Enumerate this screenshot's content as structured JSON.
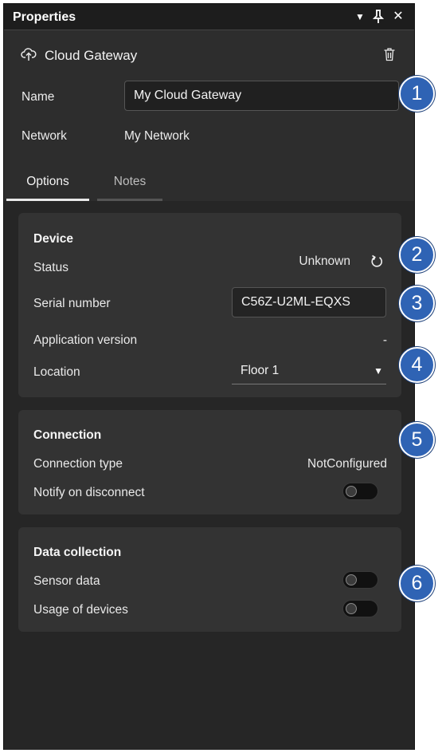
{
  "titlebar": {
    "title": "Properties",
    "icons": [
      "dropdown-arrow-icon",
      "pin-icon",
      "close-icon"
    ],
    "glyphs": {
      "menu": "▼",
      "pin": "🖈",
      "close": "✕"
    }
  },
  "header": {
    "icon": "cloud-upload-icon",
    "title": "Cloud Gateway",
    "delete_icon": "trash-icon"
  },
  "fields": {
    "name_label": "Name",
    "name_value": "My Cloud Gateway",
    "network_label": "Network",
    "network_value": "My Network"
  },
  "tabs": [
    {
      "label": "Options",
      "active": true
    },
    {
      "label": "Notes",
      "active": false
    }
  ],
  "device": {
    "title": "Device",
    "status_label": "Status",
    "status_value": "Unknown",
    "status_icon": "refresh-icon",
    "serial_label": "Serial number",
    "serial_value": "C56Z-U2ML-EQXS",
    "app_version_label": "Application version",
    "app_version_value": "-",
    "location_label": "Location",
    "location_value": "Floor 1",
    "location_caret": "▼"
  },
  "connection": {
    "title": "Connection",
    "type_label": "Connection type",
    "type_value": "NotConfigured",
    "notify_label": "Notify on disconnect",
    "notify_enabled": false
  },
  "data_collection": {
    "title": "Data collection",
    "sensor_label": "Sensor data",
    "sensor_enabled": false,
    "usage_label": "Usage of devices",
    "usage_enabled": false
  },
  "badges": [
    "1",
    "2",
    "3",
    "4",
    "5",
    "6"
  ],
  "colors": {
    "panel_bg": "#2d2d2d",
    "titlebar_bg": "#1d1d1d",
    "card_bg": "#333333",
    "badge_bg": "#2f63b4"
  }
}
